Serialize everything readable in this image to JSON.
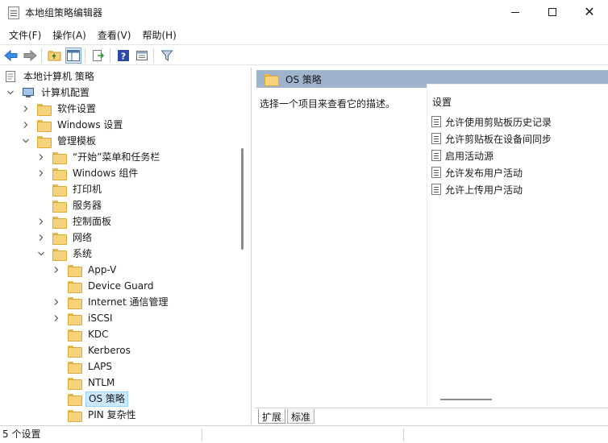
{
  "window": {
    "title": "本地组策略编辑器"
  },
  "menubar": {
    "items": [
      {
        "label": "文件(F)"
      },
      {
        "label": "操作(A)"
      },
      {
        "label": "查看(V)"
      },
      {
        "label": "帮助(H)"
      }
    ]
  },
  "toolbar": {
    "icons": [
      "back-icon",
      "forward-icon",
      "up-folder-icon",
      "show-hide-tree-icon",
      "export-list-icon",
      "help-icon",
      "properties-icon",
      "filter-icon"
    ]
  },
  "tree": {
    "items": [
      {
        "label": "本地计算机 策略"
      },
      {
        "label": "计算机配置"
      },
      {
        "label": "软件设置"
      },
      {
        "label": "Windows 设置"
      },
      {
        "label": "管理模板"
      },
      {
        "label": "“开始”菜单和任务栏"
      },
      {
        "label": "Windows 组件"
      },
      {
        "label": "打印机"
      },
      {
        "label": "服务器"
      },
      {
        "label": "控制面板"
      },
      {
        "label": "网络"
      },
      {
        "label": "系统"
      },
      {
        "label": "App-V"
      },
      {
        "label": "Device Guard"
      },
      {
        "label": "Internet 通信管理"
      },
      {
        "label": "iSCSI"
      },
      {
        "label": "KDC"
      },
      {
        "label": "Kerberos"
      },
      {
        "label": "LAPS"
      },
      {
        "label": "NTLM"
      },
      {
        "label": "OS 策略"
      },
      {
        "label": "PIN 复杂性"
      }
    ]
  },
  "details": {
    "header": "OS 策略",
    "description": "选择一个项目来查看它的描述。",
    "settings_header": "设置",
    "settings": [
      {
        "label": "允许使用剪贴板历史记录"
      },
      {
        "label": "允许剪贴板在设备间同步"
      },
      {
        "label": "启用活动源"
      },
      {
        "label": "允许发布用户活动"
      },
      {
        "label": "允许上传用户活动"
      }
    ],
    "tabs": [
      {
        "label": "扩展"
      },
      {
        "label": "标准"
      }
    ]
  },
  "status": {
    "text": "5 个设置"
  }
}
